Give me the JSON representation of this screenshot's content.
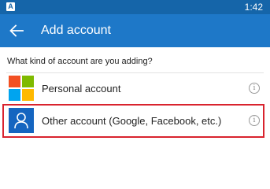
{
  "status_bar": {
    "notification_glyph": "A",
    "time": "1:42"
  },
  "app_bar": {
    "title": "Add account",
    "back_icon": "arrow-left-icon"
  },
  "content": {
    "question": "What kind of account are you adding?",
    "accounts": [
      {
        "label": "Personal account",
        "icon": "microsoft-logo-icon",
        "info_glyph": "i"
      },
      {
        "label": "Other account (Google, Facebook, etc.)",
        "icon": "person-icon",
        "info_glyph": "i"
      }
    ]
  },
  "colors": {
    "status_bar": "#1565a9",
    "app_bar": "#1e78c8",
    "person_tile": "#1565c0",
    "highlight": "#d9232e"
  }
}
